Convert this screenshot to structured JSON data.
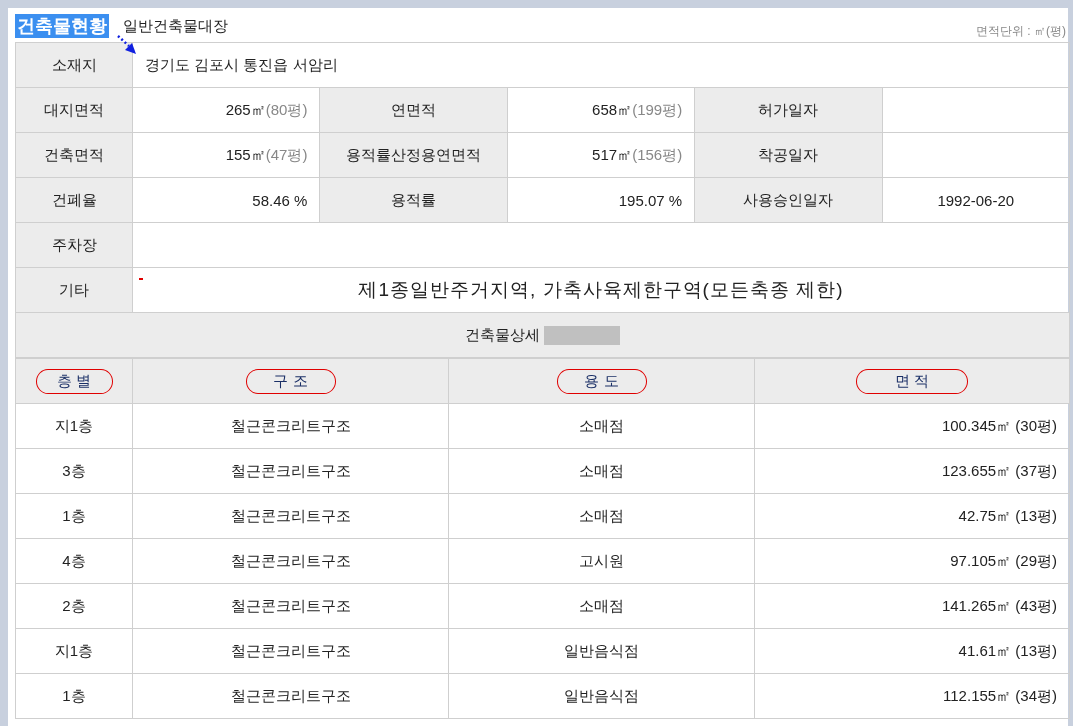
{
  "header": {
    "title": "건축물현황",
    "subtitle": "일반건축물대장",
    "unit_note": "면적단위 : ㎡(평)"
  },
  "site": {
    "label": "소재지",
    "value": "경기도 김포시 통진읍 서암리"
  },
  "summary_rows": [
    [
      {
        "label": "대지면적",
        "value": "265㎡",
        "unit": "(80평)"
      },
      {
        "label": "연면적",
        "value": "658㎡",
        "unit": "(199평)"
      },
      {
        "label": "허가일자"
      }
    ],
    [
      {
        "label": "건축면적",
        "value": "155㎡",
        "unit": "(47평)"
      },
      {
        "label": "용적률산정용연면적",
        "value": "517㎡",
        "unit": "(156평)"
      },
      {
        "label": "착공일자"
      }
    ],
    [
      {
        "label": "건폐율",
        "value": "58.46 %"
      },
      {
        "label": "용적률",
        "value": "195.07 %"
      },
      {
        "label": "사용승인일자",
        "value": "1992-06-20"
      }
    ]
  ],
  "parking": {
    "label": "주차장"
  },
  "etc": {
    "label": "기타",
    "value": "제1종일반주거지역, 가축사육제한구역(모든축종 제한)"
  },
  "detail": {
    "title": "건축물상세"
  },
  "floors": {
    "columns": [
      "층 별",
      "구 조",
      "용 도",
      "면 적"
    ],
    "rows": [
      [
        "지1층",
        "철근콘크리트구조",
        "소매점",
        "100.345㎡ (30평)"
      ],
      [
        "3층",
        "철근콘크리트구조",
        "소매점",
        "123.655㎡ (37평)"
      ],
      [
        "1층",
        "철근콘크리트구조",
        "소매점",
        "42.75㎡ (13평)"
      ],
      [
        "4층",
        "철근콘크리트구조",
        "고시원",
        "97.105㎡ (29평)"
      ],
      [
        "2층",
        "철근콘크리트구조",
        "소매점",
        "141.265㎡ (43평)"
      ],
      [
        "지1층",
        "철근콘크리트구조",
        "일반음식점",
        "41.61㎡ (13평)"
      ],
      [
        "1층",
        "철근콘크리트구조",
        "일반음식점",
        "112.155㎡ (34평)"
      ]
    ]
  }
}
